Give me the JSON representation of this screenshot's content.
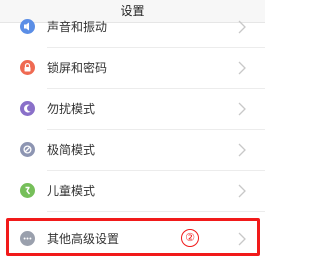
{
  "header": {
    "title": "设置"
  },
  "settings": {
    "items": [
      {
        "label": "声音和振动",
        "icon": "sound-icon",
        "color": "#5b8ee6"
      },
      {
        "label": "锁屏和密码",
        "icon": "lock-icon",
        "color": "#ef6a52"
      },
      {
        "label": "勿扰模式",
        "icon": "moon-icon",
        "color": "#8a70c9"
      },
      {
        "label": "极简模式",
        "icon": "minimal-mode-icon",
        "color": "#8d95b2"
      },
      {
        "label": "儿童模式",
        "icon": "child-mode-icon",
        "color": "#76bf5a"
      },
      {
        "label": "其他高级设置",
        "icon": "more-icon",
        "color": "#9aa0ad"
      }
    ]
  },
  "annotation": {
    "step_number": "②",
    "highlight_color": "#f11a1a"
  }
}
